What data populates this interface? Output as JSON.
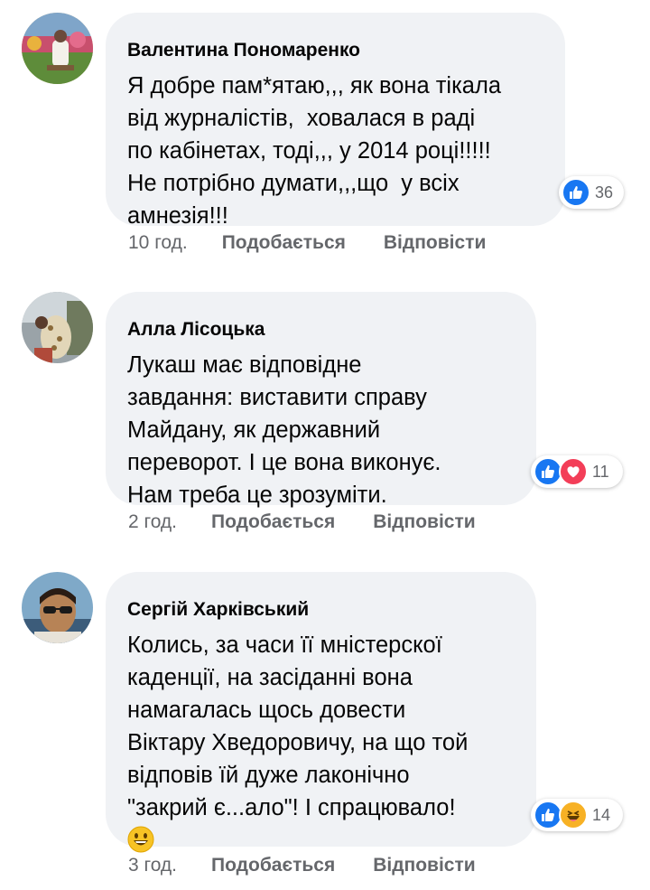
{
  "comments": [
    {
      "author": "Валентина Пономаренко",
      "lines": [
        "Я добре пам*ятаю,,, як вона тікала",
        "від журналістів,  ховалася в раді",
        "по кабінетах, тоді,,, у 2014 році!!!!!",
        "Не потрібно думати,,,що  у всіх",
        "амнезія!!!"
      ],
      "reactions": [
        "like"
      ],
      "reaction_count": "36",
      "time": "10 год.",
      "like_label": "Подобається",
      "reply_label": "Відповісти"
    },
    {
      "author": "Алла Лісоцька",
      "lines": [
        "Лукаш має відповідне",
        "завдання: виставити справу",
        "Майдану, як державний",
        "переворот. І це вона виконує.",
        "Нам треба це зрозуміти."
      ],
      "reactions": [
        "like",
        "love"
      ],
      "reaction_count": "11",
      "time": "2 год.",
      "like_label": "Подобається",
      "reply_label": "Відповісти"
    },
    {
      "author": "Сергій Харківський",
      "lines": [
        "Колись, за часи її мністерскої",
        "каденції, на засіданні вона",
        "намагалась щось довести",
        "Віктару Хведоровичу, на що той",
        "відповів їй дуже лаконічно",
        "\"закрий є...ало\"! І спрацювало!"
      ],
      "trailing_emoji": "grinning-face",
      "reactions": [
        "like",
        "haha"
      ],
      "reaction_count": "14",
      "time": "3 год.",
      "like_label": "Подобається",
      "reply_label": "Відповісти"
    }
  ],
  "colors": {
    "bubble": "#f0f2f5",
    "text": "#050505",
    "secondary": "#65676b",
    "like_blue": "#1877f2",
    "love_red": "#f33e58",
    "haha_yellow": "#f7b125"
  }
}
